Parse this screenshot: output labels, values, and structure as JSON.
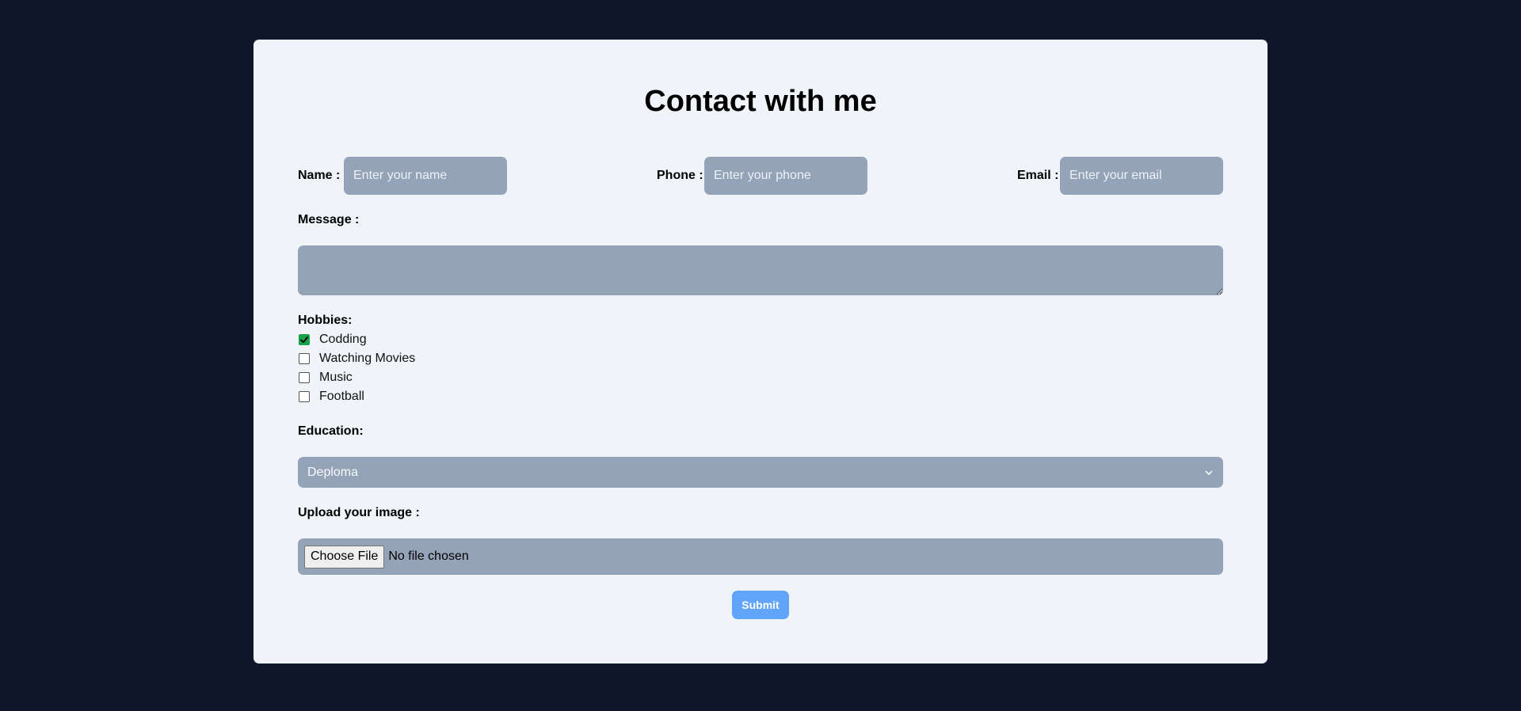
{
  "form": {
    "title": "Contact with me",
    "name": {
      "label": "Name :",
      "placeholder": "Enter your name"
    },
    "phone": {
      "label": "Phone :",
      "placeholder": "Enter your phone"
    },
    "email": {
      "label": "Email :",
      "placeholder": "Enter your email"
    },
    "message": {
      "label": "Message :",
      "value": ""
    },
    "hobbies": {
      "label": "Hobbies:",
      "items": [
        {
          "label": "Codding",
          "checked": true
        },
        {
          "label": "Watching Movies",
          "checked": false
        },
        {
          "label": "Music",
          "checked": false
        },
        {
          "label": "Football",
          "checked": false
        }
      ]
    },
    "education": {
      "label": "Education:",
      "selected": "Deploma"
    },
    "upload": {
      "label": "Upload your image :",
      "button_label": "Choose File",
      "status": "No file chosen"
    },
    "submit_label": "Submit"
  },
  "colors": {
    "page_background": "#0f172a",
    "card_background": "#f0f4f8",
    "field_background": "#94a3b8",
    "checkbox_checked": "#16a34a",
    "submit_button": "#60a5fa"
  }
}
